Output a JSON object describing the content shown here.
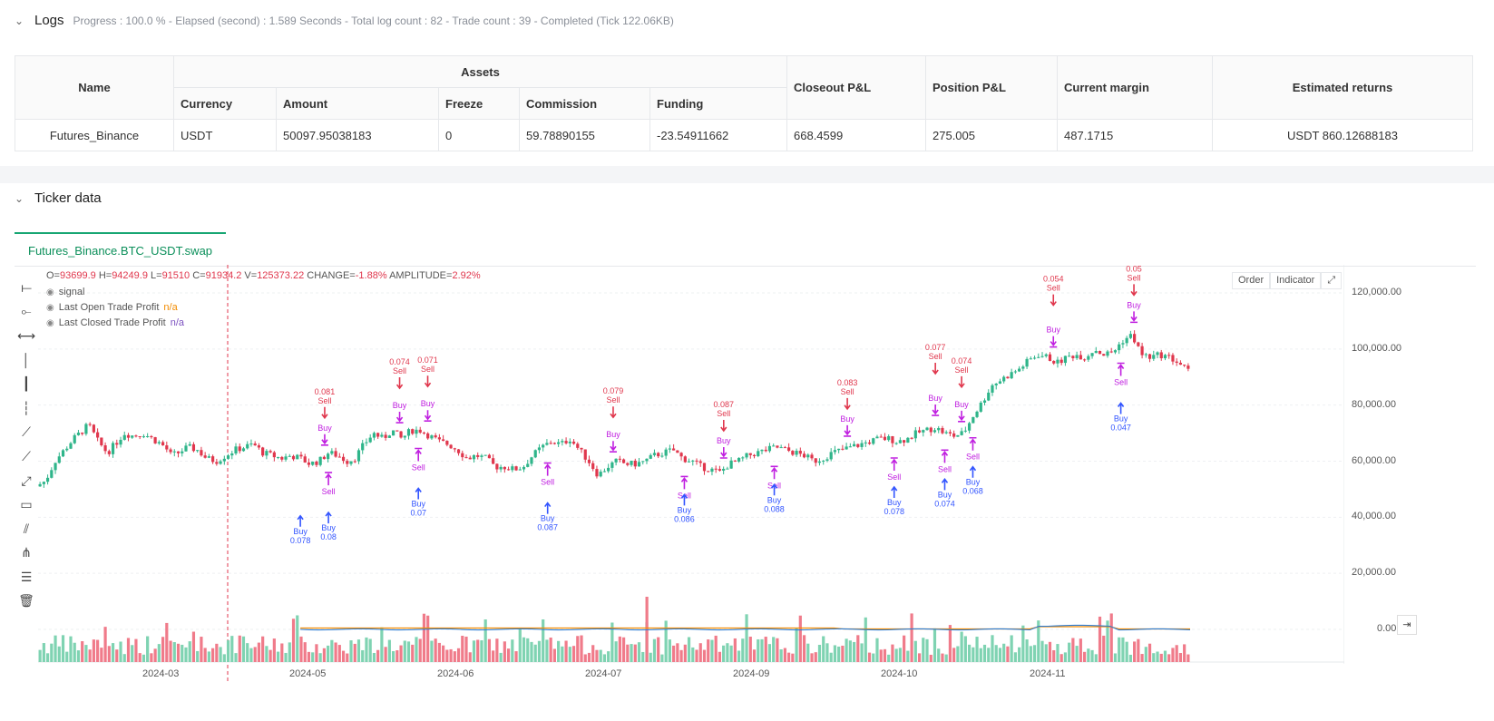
{
  "logs": {
    "title": "Logs",
    "meta": "Progress : 100.0 % - Elapsed (second) : 1.589 Seconds - Total log count : 82 - Trade count : 39 - Completed (Tick 122.06KB)"
  },
  "assets_table": {
    "headers": {
      "name": "Name",
      "assets": "Assets",
      "currency": "Currency",
      "amount": "Amount",
      "freeze": "Freeze",
      "commission": "Commission",
      "funding": "Funding",
      "closeout_pl": "Closeout P&L",
      "position_pl": "Position P&L",
      "current_margin": "Current margin",
      "estimated_returns": "Estimated returns"
    },
    "row": {
      "name": "Futures_Binance",
      "currency": "USDT",
      "amount": "50097.95038183",
      "freeze": "0",
      "commission": "59.78890155",
      "funding": "-23.54911662",
      "closeout_pl": "668.4599",
      "position_pl": "275.005",
      "current_margin": "487.1715",
      "estimated_returns": "USDT 860.12688183"
    }
  },
  "ticker": {
    "title": "Ticker data",
    "tab": "Futures_Binance.BTC_USDT.swap"
  },
  "ohlc": {
    "o_label": "O=",
    "o": "93699.9",
    "h_label": "H=",
    "h": "94249.9",
    "l_label": "L=",
    "l": "91510",
    "c_label": "C=",
    "c": "91934.2",
    "v_label": "V=",
    "v": "125373.22",
    "change_label": "CHANGE=",
    "change": "-1.88%",
    "amp_label": "AMPLITUDE=",
    "amp": "2.92%"
  },
  "legend": {
    "signal": "signal",
    "last_open": "Last Open Trade Profit",
    "last_open_val": "n/a",
    "last_closed": "Last Closed Trade Profit",
    "last_closed_val": "n/a"
  },
  "chart_buttons": {
    "order": "Order",
    "indicator": "Indicator"
  },
  "toolbar_icons": [
    "horizontal-line-icon",
    "ray-icon",
    "extended-line-icon",
    "vertical-line-icon",
    "vertical-ray-icon",
    "vertical-segment-icon",
    "trend-line-icon",
    "trend-ray-icon",
    "trend-extended-icon",
    "price-label-icon",
    "parallel-channel-icon",
    "pitchfork-icon",
    "fib-retracement-icon",
    "trash-icon"
  ],
  "colors": {
    "up": "#2fb58a",
    "down": "#e0374d",
    "buy": "#3355ff",
    "sell": "#e0374d",
    "close": "#c020e0",
    "profit_blue": "#2a7bd4",
    "profit_orange": "#f28b00"
  },
  "chart_data": {
    "type": "candlestick",
    "price_axis": {
      "ticks": [
        "120,000.00",
        "100,000.00",
        "80,000.00",
        "60,000.00",
        "40,000.00",
        "20,000.00",
        "0.00"
      ],
      "min": 0,
      "max": 120000
    },
    "x_ticks": [
      "2024-03",
      "2024-05",
      "2024-06",
      "2024-07",
      "2024-09",
      "2024-10",
      "2024-11"
    ],
    "close_path": [
      [
        0,
        51000
      ],
      [
        5,
        53000
      ],
      [
        10,
        60000
      ],
      [
        15,
        64000
      ],
      [
        20,
        68000
      ],
      [
        25,
        71000
      ],
      [
        28,
        73000
      ],
      [
        33,
        67000
      ],
      [
        38,
        63000
      ],
      [
        42,
        66000
      ],
      [
        47,
        70000
      ],
      [
        52,
        69000
      ],
      [
        57,
        70000
      ],
      [
        62,
        68000
      ],
      [
        67,
        66000
      ],
      [
        70,
        64000
      ],
      [
        72,
        62000
      ],
      [
        76,
        63000
      ],
      [
        81,
        65000
      ],
      [
        86,
        64000
      ],
      [
        91,
        61000
      ],
      [
        96,
        60000
      ],
      [
        101,
        62000
      ],
      [
        106,
        64000
      ],
      [
        111,
        65000
      ],
      [
        116,
        66000
      ],
      [
        121,
        63000
      ],
      [
        126,
        62000
      ],
      [
        131,
        61000
      ],
      [
        136,
        62000
      ],
      [
        141,
        61000
      ],
      [
        146,
        59000
      ],
      [
        151,
        60000
      ],
      [
        156,
        63000
      ],
      [
        161,
        62000
      ],
      [
        166,
        60000
      ],
      [
        170,
        61000
      ],
      [
        175,
        66000
      ],
      [
        180,
        70000
      ],
      [
        185,
        68000
      ],
      [
        190,
        71000
      ],
      [
        195,
        68000
      ],
      [
        200,
        71000
      ],
      [
        205,
        71000
      ],
      [
        210,
        69000
      ],
      [
        215,
        67000
      ],
      [
        220,
        66000
      ],
      [
        225,
        64000
      ],
      [
        230,
        61000
      ],
      [
        235,
        62000
      ],
      [
        240,
        61000
      ],
      [
        245,
        58000
      ],
      [
        250,
        58000
      ],
      [
        255,
        57000
      ],
      [
        260,
        58000
      ],
      [
        265,
        62000
      ],
      [
        270,
        65000
      ],
      [
        275,
        67000
      ],
      [
        280,
        66000
      ],
      [
        285,
        68000
      ],
      [
        290,
        64000
      ],
      [
        295,
        60000
      ],
      [
        300,
        55000
      ],
      [
        305,
        58000
      ],
      [
        310,
        60000
      ],
      [
        315,
        59000
      ],
      [
        320,
        59000
      ],
      [
        325,
        60000
      ],
      [
        330,
        62000
      ],
      [
        335,
        63000
      ],
      [
        340,
        64000
      ],
      [
        345,
        61000
      ],
      [
        350,
        60000
      ],
      [
        355,
        58000
      ],
      [
        360,
        57000
      ],
      [
        365,
        56000
      ],
      [
        370,
        59000
      ],
      [
        375,
        60000
      ],
      [
        380,
        62000
      ],
      [
        385,
        63000
      ],
      [
        390,
        64000
      ],
      [
        395,
        65000
      ],
      [
        400,
        64000
      ],
      [
        405,
        63000
      ],
      [
        410,
        62000
      ],
      [
        415,
        60000
      ],
      [
        420,
        61000
      ],
      [
        425,
        63000
      ],
      [
        430,
        64000
      ],
      [
        435,
        65000
      ],
      [
        440,
        66000
      ],
      [
        445,
        67000
      ],
      [
        450,
        68000
      ],
      [
        455,
        68000
      ],
      [
        460,
        67000
      ],
      [
        465,
        68000
      ],
      [
        470,
        70000
      ],
      [
        475,
        71000
      ],
      [
        480,
        72000
      ],
      [
        485,
        70000
      ],
      [
        490,
        69000
      ],
      [
        495,
        70000
      ],
      [
        500,
        76000
      ],
      [
        505,
        81000
      ],
      [
        510,
        87000
      ],
      [
        515,
        89000
      ],
      [
        520,
        91000
      ],
      [
        525,
        93000
      ],
      [
        530,
        96000
      ],
      [
        535,
        98000
      ],
      [
        540,
        97000
      ],
      [
        545,
        95000
      ],
      [
        550,
        97000
      ],
      [
        555,
        98000
      ],
      [
        560,
        97000
      ],
      [
        565,
        100000
      ],
      [
        570,
        98000
      ],
      [
        575,
        99000
      ],
      [
        580,
        103000
      ],
      [
        585,
        105000
      ],
      [
        590,
        98000
      ],
      [
        595,
        97000
      ],
      [
        600,
        98000
      ],
      [
        605,
        97000
      ],
      [
        610,
        95000
      ],
      [
        615,
        92000
      ]
    ],
    "x_range": [
      0,
      615
    ],
    "trades": [
      {
        "type": "buy",
        "label": "Buy",
        "size": "0.078",
        "x": 140
      },
      {
        "type": "sell",
        "label": "Sell",
        "size": "0.081",
        "x": 153
      },
      {
        "type": "close_buy",
        "label": "Buy",
        "x": 153
      },
      {
        "type": "close_sell",
        "label": "Sell",
        "x": 155
      },
      {
        "type": "buy",
        "label": "Buy",
        "size": "0.08",
        "x": 155
      },
      {
        "type": "sell",
        "label": "Sell",
        "size": "0.074",
        "x": 193
      },
      {
        "type": "close_buy",
        "label": "Buy",
        "x": 193
      },
      {
        "type": "sell",
        "label": "Sell",
        "size": "0.071",
        "x": 208
      },
      {
        "type": "close_buy",
        "label": "Buy",
        "x": 208
      },
      {
        "type": "close_sell",
        "label": "Sell",
        "x": 203
      },
      {
        "type": "buy",
        "label": "Buy",
        "size": "0.07",
        "x": 203
      },
      {
        "type": "close_sell",
        "label": "Sell",
        "x": 272
      },
      {
        "type": "buy",
        "label": "Buy",
        "size": "0.087",
        "x": 272
      },
      {
        "type": "sell",
        "label": "Sell",
        "size": "0.079",
        "x": 307
      },
      {
        "type": "close_buy",
        "label": "Buy",
        "x": 307
      },
      {
        "type": "close_sell",
        "label": "Sell",
        "x": 345
      },
      {
        "type": "buy",
        "label": "Buy",
        "size": "0.086",
        "x": 345
      },
      {
        "type": "sell",
        "label": "Sell",
        "size": "0.087",
        "x": 366
      },
      {
        "type": "close_buy",
        "label": "Buy",
        "x": 366
      },
      {
        "type": "close_sell",
        "label": "Sell",
        "x": 393
      },
      {
        "type": "buy",
        "label": "Buy",
        "size": "0.088",
        "x": 393
      },
      {
        "type": "sell",
        "label": "Sell",
        "size": "0.083",
        "x": 432
      },
      {
        "type": "close_buy",
        "label": "Buy",
        "x": 432
      },
      {
        "type": "close_sell",
        "label": "Sell",
        "x": 457
      },
      {
        "type": "buy",
        "label": "Buy",
        "size": "0.078",
        "x": 457
      },
      {
        "type": "sell",
        "label": "Sell",
        "size": "0.077",
        "x": 479
      },
      {
        "type": "close_buy",
        "label": "Buy",
        "x": 479
      },
      {
        "type": "close_sell",
        "label": "Sell",
        "x": 484
      },
      {
        "type": "buy",
        "label": "Buy",
        "size": "0.074",
        "x": 484
      },
      {
        "type": "sell",
        "label": "Sell",
        "size": "0.074",
        "x": 493
      },
      {
        "type": "close_buy",
        "label": "Buy",
        "x": 493
      },
      {
        "type": "close_sell",
        "label": "Sell",
        "x": 499
      },
      {
        "type": "buy",
        "label": "Buy",
        "size": "0.068",
        "x": 499
      },
      {
        "type": "sell",
        "label": "Sell",
        "size": "0.054",
        "x": 542
      },
      {
        "type": "close_buy",
        "label": "Buy",
        "x": 542
      },
      {
        "type": "sell",
        "label": "Sell",
        "size": "0.05",
        "x": 585
      },
      {
        "type": "close_buy",
        "label": "Buy",
        "x": 585
      },
      {
        "type": "close_sell",
        "label": "Sell",
        "x": 578
      },
      {
        "type": "buy",
        "label": "Buy",
        "size": "0.047",
        "x": 578
      }
    ]
  }
}
